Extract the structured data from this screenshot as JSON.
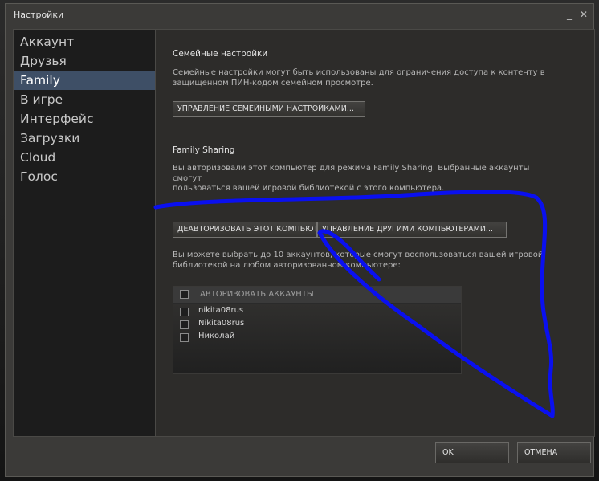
{
  "window": {
    "title": "Настройки",
    "help_label": "?",
    "minimize_label": "_",
    "close_label": "✕"
  },
  "sidebar": {
    "items": [
      {
        "label": "Аккаунт"
      },
      {
        "label": "Друзья"
      },
      {
        "label": "Family",
        "active": true
      },
      {
        "label": "В игре"
      },
      {
        "label": "Интерфейс"
      },
      {
        "label": "Загрузки"
      },
      {
        "label": "Cloud"
      },
      {
        "label": "Голос"
      }
    ]
  },
  "family_settings": {
    "heading": "Семейные настройки",
    "description_line1": "Семейные настройки могут быть использованы для ограничения доступа к контенту в",
    "description_line2": "защищенном ПИН-кодом семейном просмотре.",
    "manage_button": "УПРАВЛЕНИЕ СЕМЕЙНЫМИ НАСТРОЙКАМИ..."
  },
  "family_sharing": {
    "heading": "Family Sharing",
    "description_line1": "Вы авторизовали этот компьютер для режима Family Sharing. Выбранные аккаунты смогут",
    "description_line2": "пользоваться вашей игровой библиотекой с этого компьютера.",
    "deauthorize_button": "ДЕАВТОРИЗОВАТЬ ЭТОТ КОМПЬЮТЕР",
    "manage_computers_button": "УПРАВЛЕНИЕ ДРУГИМИ КОМПЬЮТЕРАМИ...",
    "limit_line1": "Вы можете выбрать до 10 аккаунтов, которые смогут воспользоваться вашей игровой",
    "limit_line2": "библиотекой на любом авторизованном компьютере:",
    "accounts_header": "АВТОРИЗОВАТЬ АККАУНТЫ",
    "accounts": [
      {
        "name": "nikita08rus"
      },
      {
        "name": "Nikita08rus"
      },
      {
        "name": "Николай"
      }
    ]
  },
  "footer": {
    "ok_label": "OK",
    "cancel_label": "ОТМЕНА"
  },
  "colors": {
    "window_bg": "#3b3a38",
    "sidebar_bg": "#1c1c1c",
    "sidebar_active": "#3e4f66",
    "content_bg": "#2d2c2a",
    "annotation_stroke": "#0a10f0"
  }
}
